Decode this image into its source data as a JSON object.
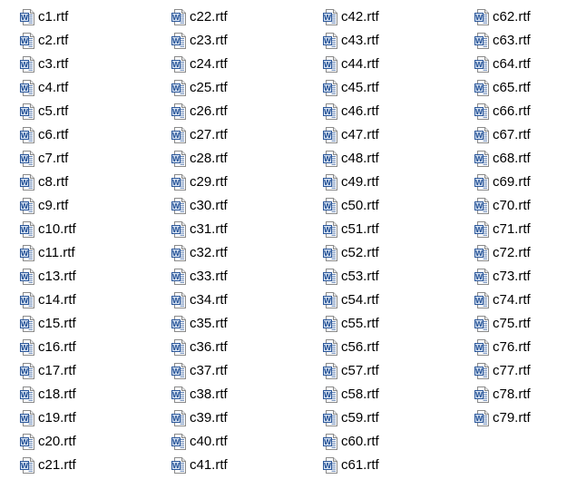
{
  "files": [
    "c1.rtf",
    "c2.rtf",
    "c3.rtf",
    "c4.rtf",
    "c5.rtf",
    "c6.rtf",
    "c7.rtf",
    "c8.rtf",
    "c9.rtf",
    "c10.rtf",
    "c11.rtf",
    "c13.rtf",
    "c14.rtf",
    "c15.rtf",
    "c16.rtf",
    "c17.rtf",
    "c18.rtf",
    "c19.rtf",
    "c20.rtf",
    "c21.rtf",
    "c22.rtf",
    "c23.rtf",
    "c24.rtf",
    "c25.rtf",
    "c26.rtf",
    "c27.rtf",
    "c28.rtf",
    "c29.rtf",
    "c30.rtf",
    "c31.rtf",
    "c32.rtf",
    "c33.rtf",
    "c34.rtf",
    "c35.rtf",
    "c36.rtf",
    "c37.rtf",
    "c38.rtf",
    "c39.rtf",
    "c40.rtf",
    "c41.rtf",
    "c42.rtf",
    "c43.rtf",
    "c44.rtf",
    "c45.rtf",
    "c46.rtf",
    "c47.rtf",
    "c48.rtf",
    "c49.rtf",
    "c50.rtf",
    "c51.rtf",
    "c52.rtf",
    "c53.rtf",
    "c54.rtf",
    "c55.rtf",
    "c56.rtf",
    "c57.rtf",
    "c58.rtf",
    "c59.rtf",
    "c60.rtf",
    "c61.rtf",
    "c62.rtf",
    "c63.rtf",
    "c64.rtf",
    "c65.rtf",
    "c66.rtf",
    "c67.rtf",
    "c68.rtf",
    "c69.rtf",
    "c70.rtf",
    "c71.rtf",
    "c72.rtf",
    "c73.rtf",
    "c74.rtf",
    "c75.rtf",
    "c76.rtf",
    "c77.rtf",
    "c78.rtf",
    "c79.rtf"
  ],
  "icon": {
    "name": "word-document-icon",
    "letter": "W",
    "accent_color": "#2b579a",
    "light_color": "#dbe6f4"
  }
}
